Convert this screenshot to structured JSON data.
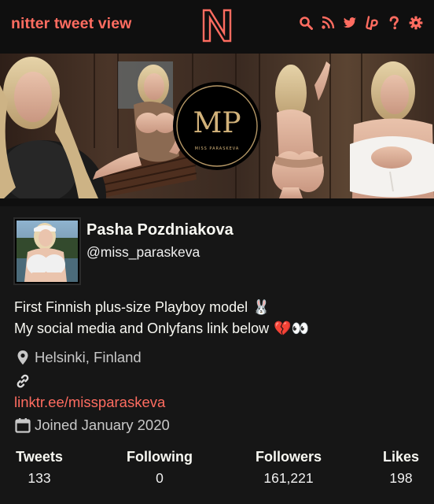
{
  "nav": {
    "brand": "nitter tweet view",
    "logo_letter": "N",
    "icons": [
      "search-icon",
      "rss-icon",
      "twitter-icon",
      "liberapay-icon",
      "help-icon",
      "settings-icon"
    ]
  },
  "banner": {
    "badge_monogram": "MP",
    "badge_caption": "MISS PARASKEVA"
  },
  "profile": {
    "fullname": "Pasha Pozdniakova",
    "username": "@miss_paraskeva",
    "bio": {
      "line1": "First Finnish plus-size Playboy model",
      "line1_emoji": "🐰",
      "line2": "My social media and Onlyfans link below",
      "line2_emoji": "💔👀"
    },
    "location": "Helsinki, Finland",
    "website": "linktr.ee/missparaskeva",
    "joined": "Joined January 2020"
  },
  "stats": {
    "tweets_label": "Tweets",
    "tweets_value": "133",
    "following_label": "Following",
    "following_value": "0",
    "followers_label": "Followers",
    "followers_value": "161,221",
    "likes_label": "Likes",
    "likes_value": "198"
  },
  "colors": {
    "accent": "#ff6c60",
    "background": "#0f0f0f",
    "card": "#161616",
    "text": "#f8f8f2",
    "muted": "#c8c8c8"
  }
}
